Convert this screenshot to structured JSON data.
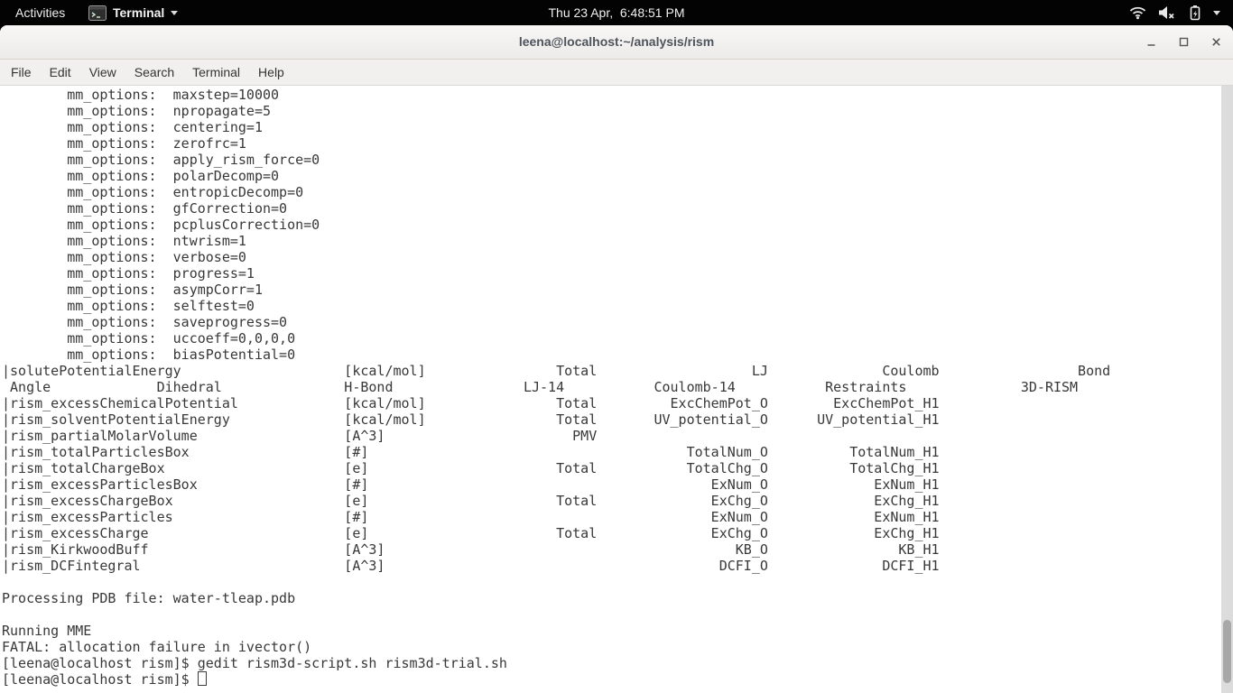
{
  "top_bar": {
    "activities_label": "Activities",
    "app_menu_label": "Terminal",
    "clock": "Thu 23 Apr,  6:48:51 PM"
  },
  "window": {
    "title": "leena@localhost:~/analysis/rism",
    "controls": [
      "minimize",
      "maximize",
      "close"
    ]
  },
  "menu_bar": {
    "items": [
      "File",
      "Edit",
      "View",
      "Search",
      "Terminal",
      "Help"
    ]
  },
  "icons": {
    "top_bar_left": [
      "terminal-app-icon",
      "chevron-down-icon"
    ],
    "status": [
      "wifi-icon",
      "volume-muted-icon",
      "battery-icon",
      "chevron-down-icon"
    ]
  },
  "colors": {
    "top_bar_bg": "#030303",
    "top_bar_fg": "#ededed",
    "titlebar_bg": "#f1efec",
    "menubar_bg": "#f1f0ee",
    "terminal_bg": "#ffffff",
    "terminal_fg": "#383838",
    "scrollbar_trough": "#dcdcdc",
    "scrollbar_thumb": "#a8a8a8"
  },
  "terminal": {
    "lines": [
      "        mm_options:  maxstep=10000",
      "        mm_options:  npropagate=5",
      "        mm_options:  centering=1",
      "        mm_options:  zerofrc=1",
      "        mm_options:  apply_rism_force=0",
      "        mm_options:  polarDecomp=0",
      "        mm_options:  entropicDecomp=0",
      "        mm_options:  gfCorrection=0",
      "        mm_options:  pcplusCorrection=0",
      "        mm_options:  ntwrism=1",
      "        mm_options:  verbose=0",
      "        mm_options:  progress=1",
      "        mm_options:  asympCorr=1",
      "        mm_options:  selftest=0",
      "        mm_options:  saveprogress=0",
      "        mm_options:  uccoeff=0,0,0,0",
      "        mm_options:  biasPotential=0",
      "|solutePotentialEnergy                    [kcal/mol]                Total                   LJ              Coulomb                 Bond",
      " Angle             Dihedral               H-Bond                LJ-14           Coulomb-14           Restraints              3D-RISM",
      "|rism_excessChemicalPotential             [kcal/mol]                Total         ExcChemPot_O        ExcChemPot_H1",
      "|rism_solventPotentialEnergy              [kcal/mol]                Total       UV_potential_O      UV_potential_H1",
      "|rism_partialMolarVolume                  [A^3]                       PMV",
      "|rism_totalParticlesBox                   [#]                                       TotalNum_O          TotalNum_H1",
      "|rism_totalChargeBox                      [e]                       Total           TotalChg_O          TotalChg_H1",
      "|rism_excessParticlesBox                  [#]                                          ExNum_O             ExNum_H1",
      "|rism_excessChargeBox                     [e]                       Total              ExChg_O             ExChg_H1",
      "|rism_excessParticles                     [#]                                          ExNum_O             ExNum_H1",
      "|rism_excessCharge                        [e]                       Total              ExChg_O             ExChg_H1",
      "|rism_KirkwoodBuff                        [A^3]                                           KB_O                KB_H1",
      "|rism_DCFintegral                         [A^3]                                         DCFI_O              DCFI_H1",
      "",
      "Processing PDB file: water-tleap.pdb",
      "",
      "Running MME",
      "FATAL: allocation failure in ivector()",
      "[leena@localhost rism]$ gedit rism3d-script.sh rism3d-trial.sh"
    ],
    "prompt_line": "[leena@localhost rism]$ "
  }
}
